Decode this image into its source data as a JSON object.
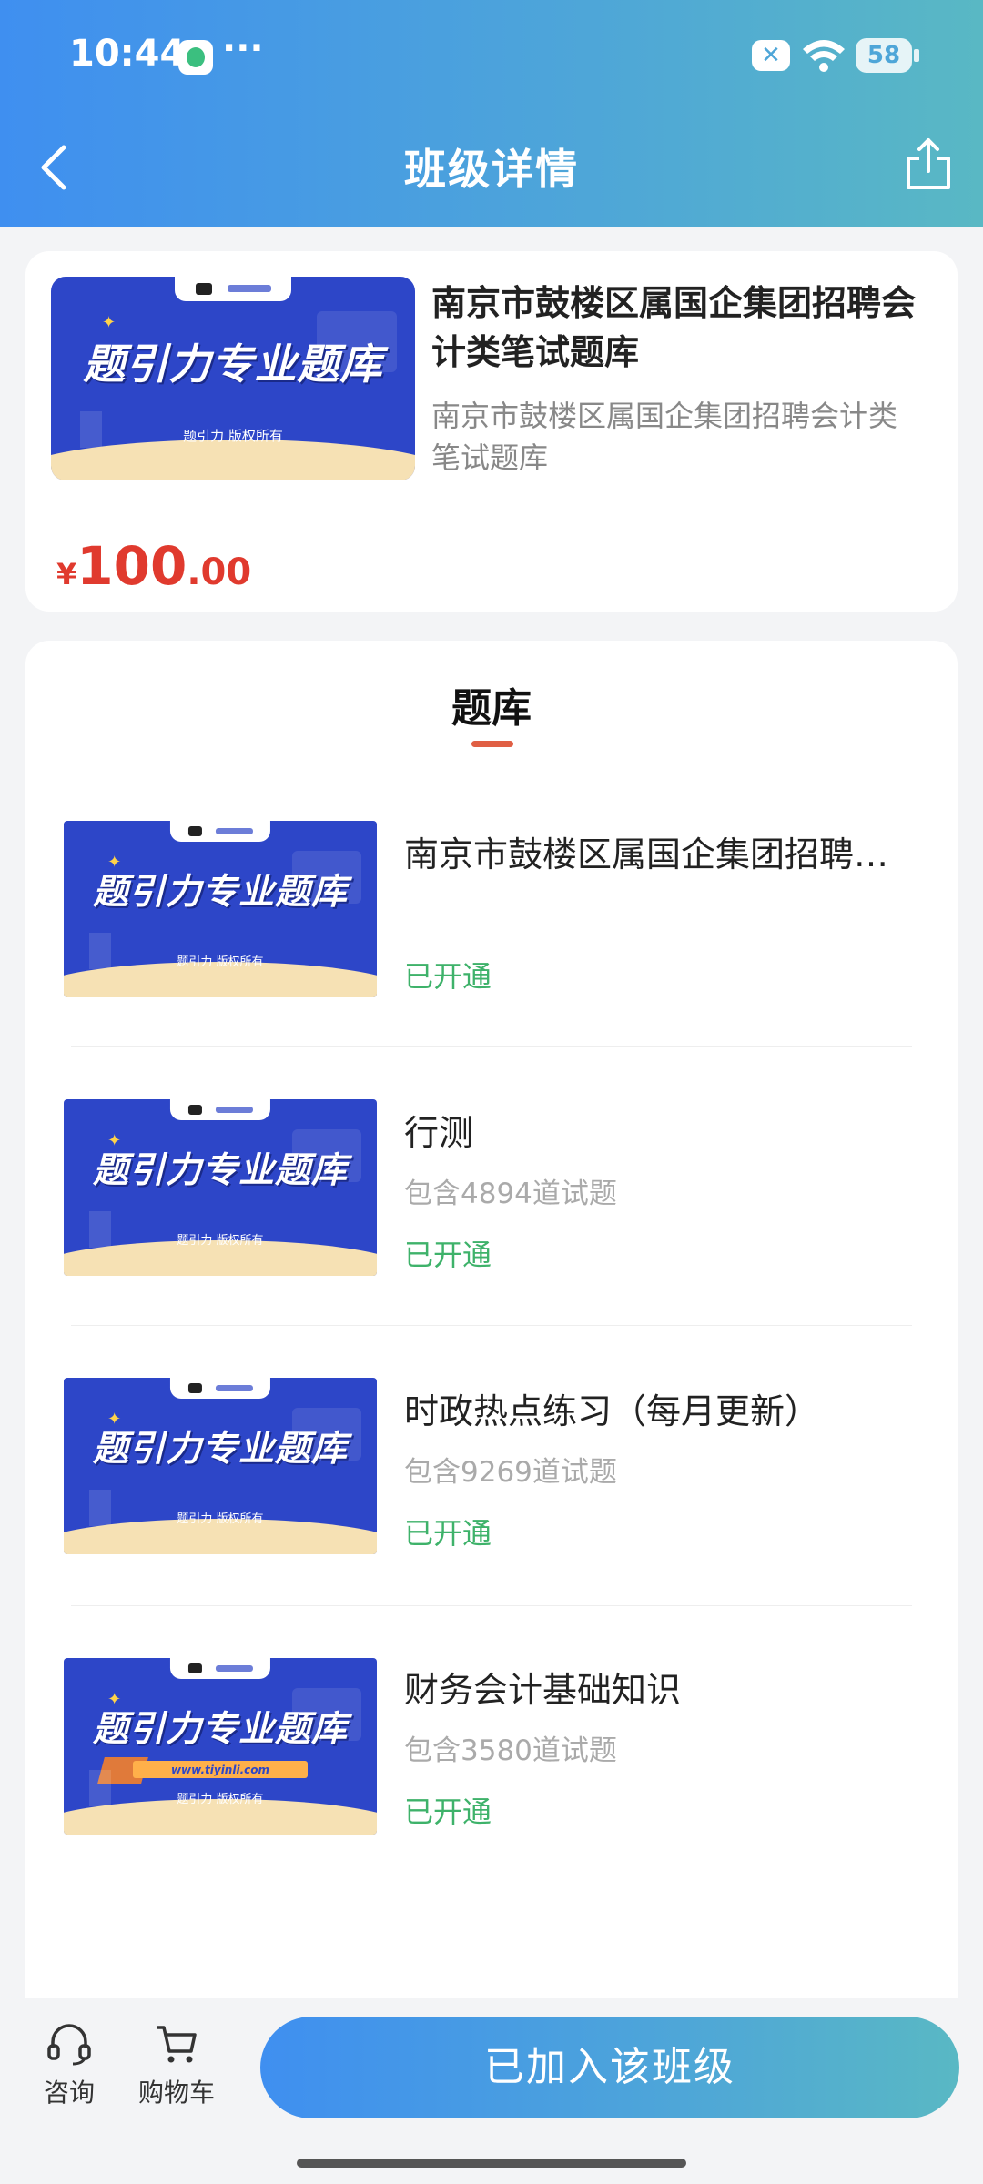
{
  "status_bar": {
    "time": "10:44",
    "dots": "···",
    "battery": "58"
  },
  "header": {
    "title": "班级详情"
  },
  "class_info": {
    "title": "南京市鼓楼区属国企集团招聘会计类笔试题库",
    "description": "南京市鼓楼区属国企集团招聘会计类笔试题库",
    "price_currency": "¥",
    "price_integer": "100",
    "price_decimal": ".00"
  },
  "cover": {
    "banner_text": "题引力专业题库",
    "copyright": "题引力 版权所有",
    "url": "www.tiyinli.com"
  },
  "section": {
    "title": "题库"
  },
  "banks": [
    {
      "title": "南京市鼓楼区属国企集团招聘会计类笔试题库",
      "count": "",
      "status": "已开通"
    },
    {
      "title": "行测",
      "count": "包含4894道试题",
      "status": "已开通"
    },
    {
      "title": "时政热点练习（每月更新）",
      "count": "包含9269道试题",
      "status": "已开通"
    },
    {
      "title": "财务会计基础知识",
      "count": "包含3580道试题",
      "status": "已开通"
    }
  ],
  "bottom_bar": {
    "consult_label": "咨询",
    "cart_label": "购物车",
    "join_label": "已加入该班级"
  },
  "colors": {
    "accent_start": "#3f8ff0",
    "accent_end": "#59b8c4",
    "price": "#e03a2e",
    "status_green": "#3eb26a"
  }
}
